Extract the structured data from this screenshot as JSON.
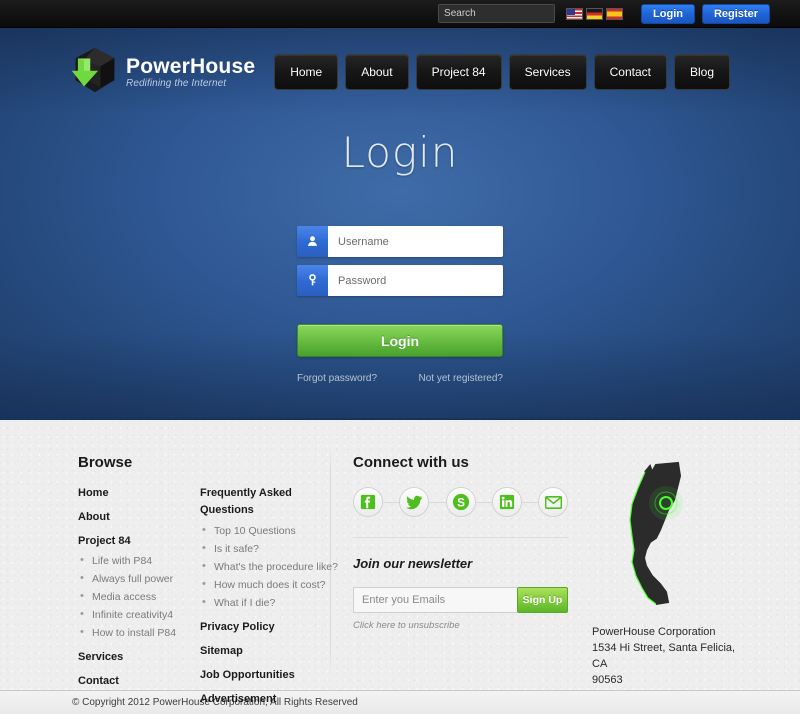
{
  "topbar": {
    "search": {
      "placeholder": "Search",
      "value": "",
      "icon": "search-icon"
    },
    "flags": [
      {
        "name": "flag-us",
        "label": "English"
      },
      {
        "name": "flag-de",
        "label": "Deutsch"
      },
      {
        "name": "flag-es",
        "label": "Espanol"
      }
    ],
    "login_label": "Login",
    "register_label": "Register",
    "bg_color": "#121212",
    "button_color": "#1f64d6"
  },
  "header": {
    "logo": {
      "title": "PowerHouse",
      "tagline": "Redifining the Internet",
      "mark": "cube-arrow-logo-icon",
      "mark_colors": {
        "dark": "#1e1e1e",
        "green": "#62d440"
      }
    },
    "nav": [
      {
        "label": "Home"
      },
      {
        "label": "About"
      },
      {
        "label": "Project 84"
      },
      {
        "label": "Services"
      },
      {
        "label": "Contact"
      },
      {
        "label": "Blog"
      }
    ]
  },
  "hero": {
    "title": "Login",
    "bg_color": "#2f5894",
    "fields": [
      {
        "name": "username",
        "icon": "user-icon",
        "placeholder": "Username",
        "value": ""
      },
      {
        "name": "password",
        "icon": "key-icon",
        "placeholder": "Password",
        "value": ""
      }
    ],
    "submit_label": "Login",
    "submit_color": "#6cc342",
    "forgot_label": "Forgot password?",
    "register_label": "Not yet registered?"
  },
  "footer": {
    "browse": {
      "heading": "Browse",
      "col_a": [
        {
          "label": "Home",
          "children": []
        },
        {
          "label": "About",
          "children": []
        },
        {
          "label": "Project 84",
          "children": [
            "Life with P84",
            "Always full power",
            "Media access",
            "Infinite creativity4",
            "How to install P84"
          ]
        },
        {
          "label": "Services",
          "children": []
        },
        {
          "label": "Contact",
          "children": []
        }
      ],
      "col_b": [
        {
          "label": "Frequently Asked Questions",
          "children": [
            "Top 10 Questions",
            "Is it safe?",
            "What's the procedure like?",
            "How much does it cost?",
            "What if I die?"
          ]
        },
        {
          "label": "Privacy Policy",
          "children": []
        },
        {
          "label": "Sitemap",
          "children": []
        },
        {
          "label": "Job Opportunities",
          "children": []
        },
        {
          "label": "Advertisement",
          "children": []
        }
      ]
    },
    "connect": {
      "heading": "Connect with us",
      "socials": [
        {
          "name": "facebook-icon",
          "label": "f"
        },
        {
          "name": "twitter-icon",
          "label": "t"
        },
        {
          "name": "skype-icon",
          "label": "S"
        },
        {
          "name": "linkedin-icon",
          "label": "in"
        },
        {
          "name": "email-icon",
          "label": "@"
        }
      ],
      "newsletter_heading": "Join our newsletter",
      "newsletter_placeholder": "Enter you Emails",
      "newsletter_value": "",
      "signup_label": "Sign Up",
      "unsubscribe_label": "Click here to unsubscribe",
      "accent_color": "#62c32c"
    },
    "location": {
      "map": "california-map-icon",
      "marker": "location-marker-icon",
      "company": "PowerHouse Corporation",
      "address_line1": "1534 Hi Street, Santa Felicia, CA",
      "address_line2": "90563"
    }
  },
  "copyright": {
    "text": "© Copyright 2012 PowerHouse Corporation, All Rights Reserved"
  }
}
